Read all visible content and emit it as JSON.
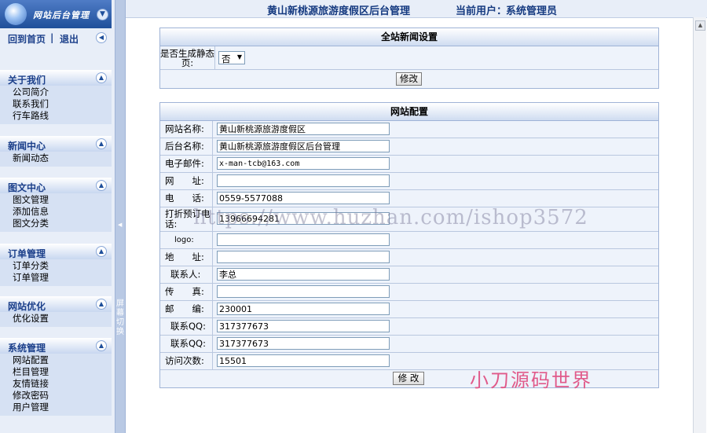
{
  "sidebar": {
    "logo_text": "网站后台管理",
    "home_link": "回到首页",
    "separator": "|",
    "logout_link": "退出",
    "groups": [
      {
        "title": "关于我们",
        "items": [
          "公司简介",
          "联系我们",
          "行车路线"
        ]
      },
      {
        "title": "新闻中心",
        "items": [
          "新闻动态"
        ]
      },
      {
        "title": "图文中心",
        "items": [
          "图文管理",
          "添加信息",
          "图文分类"
        ]
      },
      {
        "title": "订单管理",
        "items": [
          "订单分类",
          "订单管理"
        ]
      },
      {
        "title": "网站优化",
        "items": [
          "优化设置"
        ]
      },
      {
        "title": "系统管理",
        "items": [
          "网站配置",
          "栏目管理",
          "友情链接",
          "修改密码",
          "用户管理"
        ]
      }
    ],
    "splitter_label": "屏幕切换"
  },
  "header": {
    "title": "黄山新桃源旅游度假区后台管理",
    "user_label": "当前用户：",
    "user_name": "系统管理员"
  },
  "news_settings": {
    "title": "全站新闻设置",
    "static_label": "是否生成静态页:",
    "static_value": "否",
    "submit": "修改"
  },
  "site_config": {
    "title": "网站配置",
    "fields": [
      {
        "label": "网站名称:",
        "value": "黄山新桃源旅游度假区"
      },
      {
        "label": "后台名称:",
        "value": "黄山新桃源旅游度假区后台管理"
      },
      {
        "label": "电子邮件:",
        "value": "x-man-tcb@163.com"
      },
      {
        "label": "网　　址:",
        "value": ""
      },
      {
        "label": "电　　话:",
        "value": "0559-5577088"
      },
      {
        "label": "打折预订电话:",
        "value": "13966694281"
      },
      {
        "label": "logo:",
        "value": ""
      },
      {
        "label": "地　　址:",
        "value": ""
      },
      {
        "label": "联系人:",
        "value": "李总"
      },
      {
        "label": "传　　真:",
        "value": ""
      },
      {
        "label": "邮　　编:",
        "value": "230001"
      },
      {
        "label": "联系QQ:",
        "value": "317377673"
      },
      {
        "label": "联系QQ:",
        "value": "317377673"
      },
      {
        "label": "访问次数:",
        "value": "15501"
      }
    ],
    "submit": "修 改"
  },
  "overlays": {
    "watermark": "https://www.huzhan.com/ishop3572",
    "signature": "小刀源码世界"
  },
  "colors": {
    "accent": "#153a80",
    "row_bg": "#eef3fb",
    "sidebar_bg": "#d6e1f3"
  }
}
